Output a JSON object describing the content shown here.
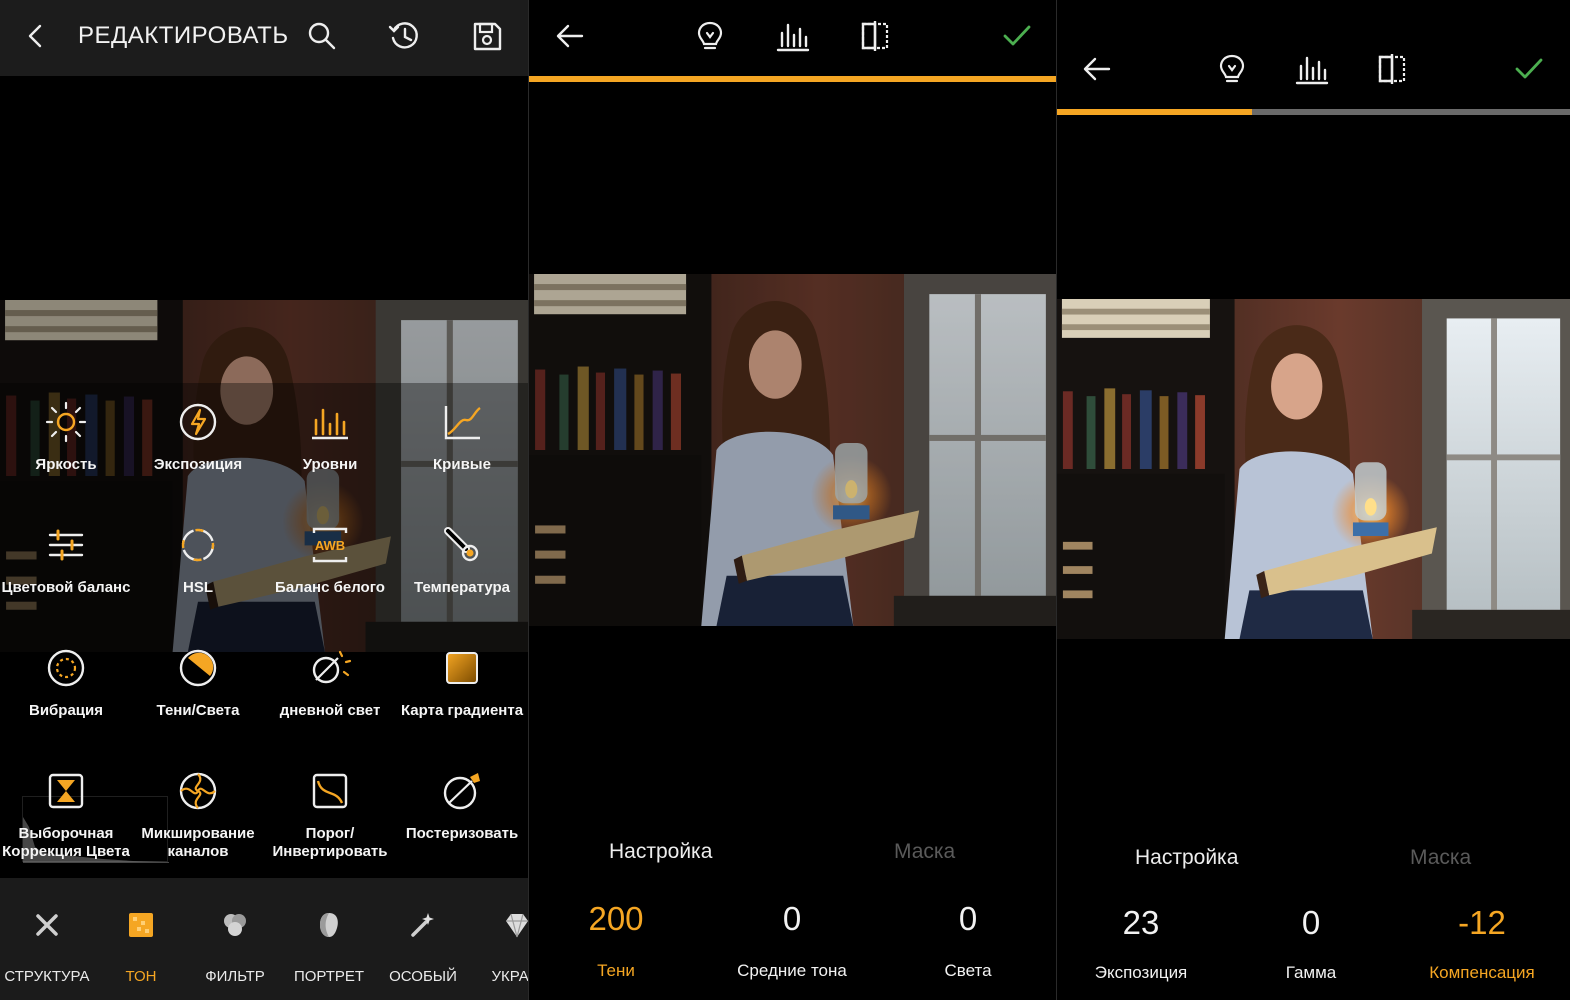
{
  "panel1": {
    "title": "РЕДАКТИРОВАТЬ",
    "icons": [
      "back-icon",
      "search-icon",
      "history-icon",
      "save-icon"
    ],
    "tools": [
      {
        "label": "Яркость",
        "icon": "brightness-icon"
      },
      {
        "label": "Экспозиция",
        "icon": "exposure-icon"
      },
      {
        "label": "Уровни",
        "icon": "levels-icon"
      },
      {
        "label": "Кривые",
        "icon": "curves-icon"
      },
      {
        "label": "Цветовой баланс",
        "icon": "color-balance-icon"
      },
      {
        "label": "HSL",
        "icon": "hsl-icon"
      },
      {
        "label": "Баланс белого",
        "icon": "white-balance-icon"
      },
      {
        "label": "Температура",
        "icon": "temperature-icon"
      },
      {
        "label": "Вибрация",
        "icon": "vibrance-icon"
      },
      {
        "label": "Тени/Света",
        "icon": "shadows-highlights-icon"
      },
      {
        "label": "дневной свет",
        "icon": "daylight-icon"
      },
      {
        "label": "Карта градиента",
        "icon": "gradient-map-icon"
      },
      {
        "label": "Выборочная Коррекция Цвета",
        "icon": "selective-color-icon"
      },
      {
        "label": "Микширование каналов",
        "icon": "channel-mixer-icon"
      },
      {
        "label": "Порог/ Инвертировать",
        "icon": "threshold-invert-icon"
      },
      {
        "label": "Постеризовать",
        "icon": "posterize-icon"
      }
    ],
    "categories": [
      {
        "label": "СТРУКТУРА",
        "icon": "structure-icon",
        "active": false
      },
      {
        "label": "ТОН",
        "icon": "tone-icon",
        "active": true
      },
      {
        "label": "ФИЛЬТР",
        "icon": "filter-icon",
        "active": false
      },
      {
        "label": "ПОРТРЕТ",
        "icon": "portrait-icon",
        "active": false
      },
      {
        "label": "ОСОБЫЙ",
        "icon": "special-icon",
        "active": false
      },
      {
        "label": "УКРАШ",
        "icon": "decoration-icon",
        "active": false
      }
    ]
  },
  "panel2": {
    "icons": [
      "back-arrow-icon",
      "lightbulb-icon",
      "histogram-icon",
      "compare-icon",
      "check-icon"
    ],
    "progress": 1.0,
    "tabs": {
      "settings": "Настройка",
      "mask": "Маска"
    },
    "params": [
      {
        "value": "200",
        "label": "Тени",
        "highlight": true
      },
      {
        "value": "0",
        "label": "Средние тона",
        "highlight": false
      },
      {
        "value": "0",
        "label": "Света",
        "highlight": false
      }
    ]
  },
  "panel3": {
    "icons": [
      "back-arrow-icon",
      "lightbulb-icon",
      "histogram-icon",
      "compare-icon",
      "check-icon"
    ],
    "progress": 0.38,
    "tabs": {
      "settings": "Настройка",
      "mask": "Маска"
    },
    "params": [
      {
        "value": "23",
        "label": "Экспозиция",
        "highlight": false
      },
      {
        "value": "0",
        "label": "Гамма",
        "highlight": false
      },
      {
        "value": "-12",
        "label": "Компенсация",
        "highlight": true
      }
    ]
  },
  "colors": {
    "accent": "#f5a623",
    "check": "#4caf50",
    "toolbar": "#1c1c1c"
  }
}
